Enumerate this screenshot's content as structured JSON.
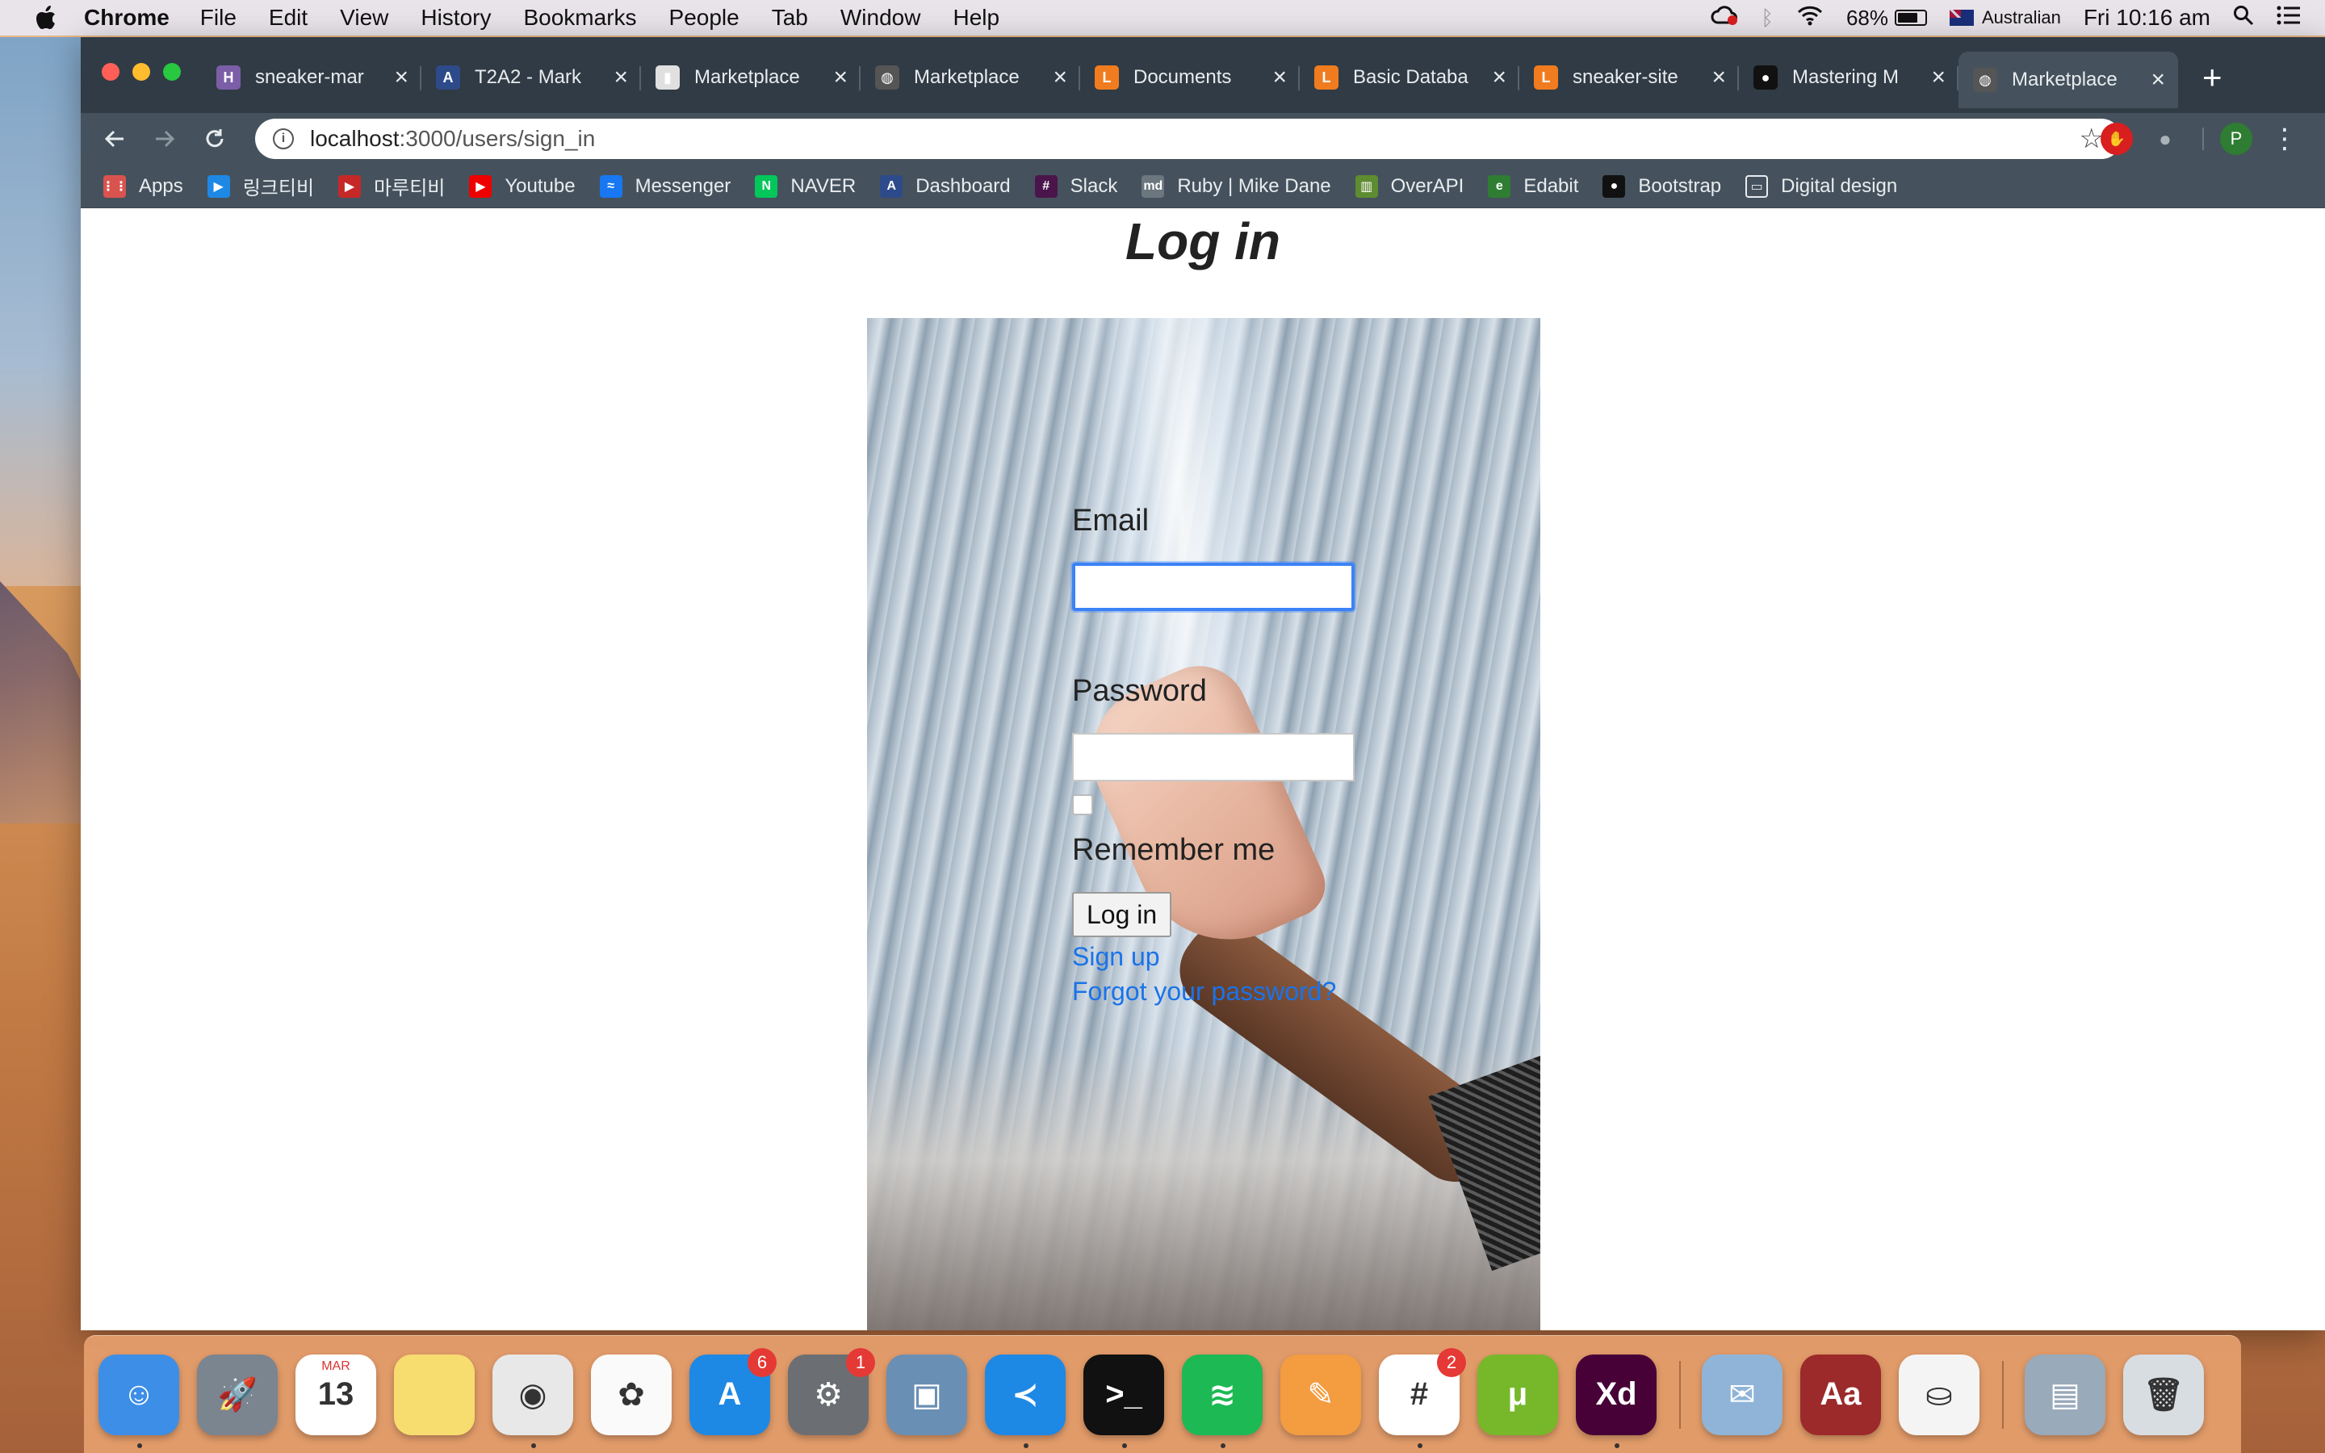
{
  "menubar": {
    "app_name": "Chrome",
    "menus": [
      "File",
      "Edit",
      "View",
      "History",
      "Bookmarks",
      "People",
      "Tab",
      "Window",
      "Help"
    ],
    "battery": "68%",
    "input_source": "Australian",
    "clock": "Fri 10:16 am"
  },
  "tabs": [
    {
      "title": "sneaker-mar",
      "favicon": "heroku-icon",
      "color": "#7b5ea7",
      "glyph": "H"
    },
    {
      "title": "T2A2 - Mark",
      "favicon": "canvas-icon",
      "color": "#2d4a8a",
      "glyph": "A"
    },
    {
      "title": "Marketplace",
      "favicon": "document-icon",
      "color": "#e0e0e0",
      "glyph": "▮"
    },
    {
      "title": "Marketplace",
      "favicon": "globe-icon",
      "color": "#555",
      "glyph": "◍"
    },
    {
      "title": "Documents",
      "favicon": "lucid-icon",
      "color": "#f07c1f",
      "glyph": "L"
    },
    {
      "title": "Basic Databa",
      "favicon": "lucid-icon",
      "color": "#f07c1f",
      "glyph": "L"
    },
    {
      "title": "sneaker-site",
      "favicon": "lucid-icon",
      "color": "#f07c1f",
      "glyph": "L"
    },
    {
      "title": "Mastering M",
      "favicon": "github-icon",
      "color": "#111",
      "glyph": "●"
    },
    {
      "title": "Marketplace",
      "favicon": "globe-icon",
      "color": "#555",
      "glyph": "◍",
      "active": true
    }
  ],
  "omnibox": {
    "host": "localhost",
    "path": ":3000/users/sign_in"
  },
  "profile_initial": "P",
  "bookmarks": [
    {
      "label": "Apps",
      "icon": "apps-grid-icon",
      "color": "#d9534f",
      "glyph": "⋮⋮"
    },
    {
      "label": "링크티비",
      "icon": "linktv-icon",
      "color": "#1e88e5",
      "glyph": "▶"
    },
    {
      "label": "마루티비",
      "icon": "marutv-icon",
      "color": "#c62828",
      "glyph": "▶"
    },
    {
      "label": "Youtube",
      "icon": "youtube-icon",
      "color": "#e00",
      "glyph": "▶"
    },
    {
      "label": "Messenger",
      "icon": "messenger-icon",
      "color": "#1877f2",
      "glyph": "≈"
    },
    {
      "label": "NAVER",
      "icon": "naver-icon",
      "color": "#03c75a",
      "glyph": "N"
    },
    {
      "label": "Dashboard",
      "icon": "canvas-icon",
      "color": "#2d4a8a",
      "glyph": "A"
    },
    {
      "label": "Slack",
      "icon": "slack-icon",
      "color": "#4a154b",
      "glyph": "#"
    },
    {
      "label": "Ruby | Mike Dane",
      "icon": "mikedane-icon",
      "color": "#6b767f",
      "glyph": "md"
    },
    {
      "label": "OverAPI",
      "icon": "overapi-icon",
      "color": "#5e8c31",
      "glyph": "▥"
    },
    {
      "label": "Edabit",
      "icon": "edabit-icon",
      "color": "#2e7d32",
      "glyph": "e"
    },
    {
      "label": "Bootstrap",
      "icon": "github-icon",
      "color": "#111",
      "glyph": "●"
    },
    {
      "label": "Digital design",
      "icon": "folder-icon",
      "color": "transparent",
      "glyph": "▭"
    }
  ],
  "page": {
    "title": "Log in",
    "email_label": "Email",
    "email_value": "",
    "password_label": "Password",
    "password_value": "",
    "remember_label": "Remember me",
    "submit_label": "Log in",
    "signup_link": "Sign up",
    "forgot_link": "Forgot your password?"
  },
  "dock": [
    {
      "name": "finder-icon",
      "color": "#3d8ee6",
      "glyph": "☺",
      "running": true
    },
    {
      "name": "launchpad-icon",
      "color": "#7a8590",
      "glyph": "🚀",
      "running": false
    },
    {
      "name": "calendar-icon",
      "color": "#ffffff",
      "glyph": "13",
      "label": "MAR",
      "running": false
    },
    {
      "name": "notes-icon",
      "color": "#f7dc6f",
      "glyph": "",
      "running": false
    },
    {
      "name": "chrome-icon",
      "color": "#e8e8e8",
      "glyph": "◉",
      "running": true
    },
    {
      "name": "photos-icon",
      "color": "#fafafa",
      "glyph": "✿",
      "running": false
    },
    {
      "name": "app-store-icon",
      "color": "#1e88e5",
      "glyph": "A",
      "badge": "6",
      "running": false
    },
    {
      "name": "system-preferences-icon",
      "color": "#6b6f73",
      "glyph": "⚙",
      "badge": "1",
      "running": false
    },
    {
      "name": "preview-icon",
      "color": "#6a8fb5",
      "glyph": "▣",
      "running": false
    },
    {
      "name": "vscode-icon",
      "color": "#1e88e5",
      "glyph": "≺",
      "running": true
    },
    {
      "name": "terminal-icon",
      "color": "#111",
      "glyph": ">_",
      "running": true
    },
    {
      "name": "spotify-icon",
      "color": "#1db954",
      "glyph": "≋",
      "running": true
    },
    {
      "name": "pages-icon",
      "color": "#f39c40",
      "glyph": "✎",
      "running": false
    },
    {
      "name": "slack-icon",
      "color": "#ffffff",
      "glyph": "#",
      "badge": "2",
      "running": true
    },
    {
      "name": "utorrent-icon",
      "color": "#76b82a",
      "glyph": "μ",
      "running": false
    },
    {
      "name": "adobe-xd-icon",
      "color": "#470137",
      "glyph": "Xd",
      "running": true
    },
    {
      "name": "mail-icon",
      "color": "#8fb4d8",
      "glyph": "✉",
      "running": false
    },
    {
      "name": "dictionary-icon",
      "color": "#9c2a2a",
      "glyph": "Aa",
      "running": false
    },
    {
      "name": "sequel-pro-icon",
      "color": "#f4f4f4",
      "glyph": "⛀",
      "running": false
    },
    {
      "name": "downloads-stack-icon",
      "color": "#9ab",
      "glyph": "▤",
      "running": false
    },
    {
      "name": "trash-icon",
      "color": "#d8dde2",
      "glyph": "🗑",
      "running": false
    }
  ]
}
